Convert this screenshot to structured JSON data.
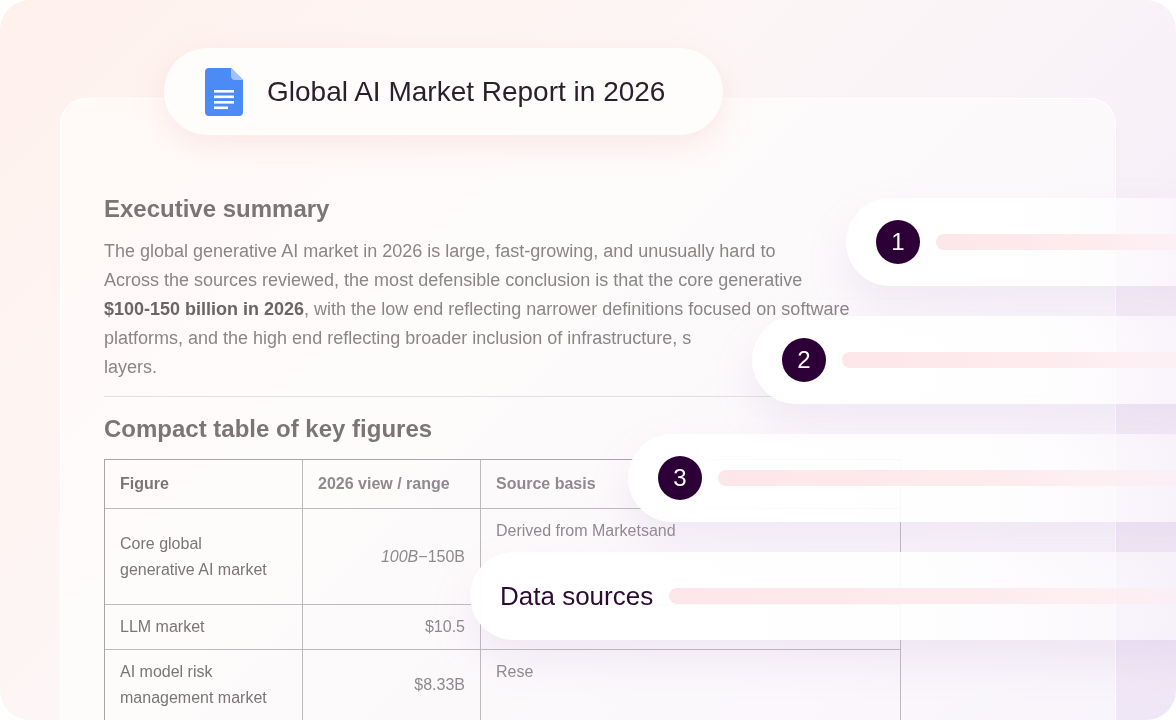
{
  "title_chip": {
    "title": "Global AI Market Report in 2026"
  },
  "document": {
    "summary_heading": "Executive summary",
    "summary_lines": [
      "The global generative AI market in 2026 is large, fast-growing, and unusually hard to",
      "Across the sources reviewed, the most defensible conclusion is that the core generative",
      "**$100-150 billion in 2026**, with the low end reflecting narrower definitions focused on software",
      "platforms, and the high end reflecting broader inclusion of infrastructure, s",
      "layers."
    ],
    "table_heading": "Compact table of key figures",
    "table": {
      "columns": [
        "Figure",
        "2026 view / range",
        "Source basis"
      ],
      "rows": [
        {
          "cells": [
            "Core global\ngenerative AI market",
            "*100B*−150B",
            "Derived from Marketsand"
          ]
        },
        {
          "cells": [
            "LLM market",
            "$10.5"
          ]
        },
        {
          "cells": [
            "AI model risk\nmanagement market",
            "$8.33B",
            "Rese"
          ]
        }
      ]
    }
  },
  "steps": [
    {
      "kind": "number",
      "label": "1"
    },
    {
      "kind": "number",
      "label": "2"
    },
    {
      "kind": "number",
      "label": "3"
    },
    {
      "kind": "text",
      "label": "Data sources"
    }
  ]
}
